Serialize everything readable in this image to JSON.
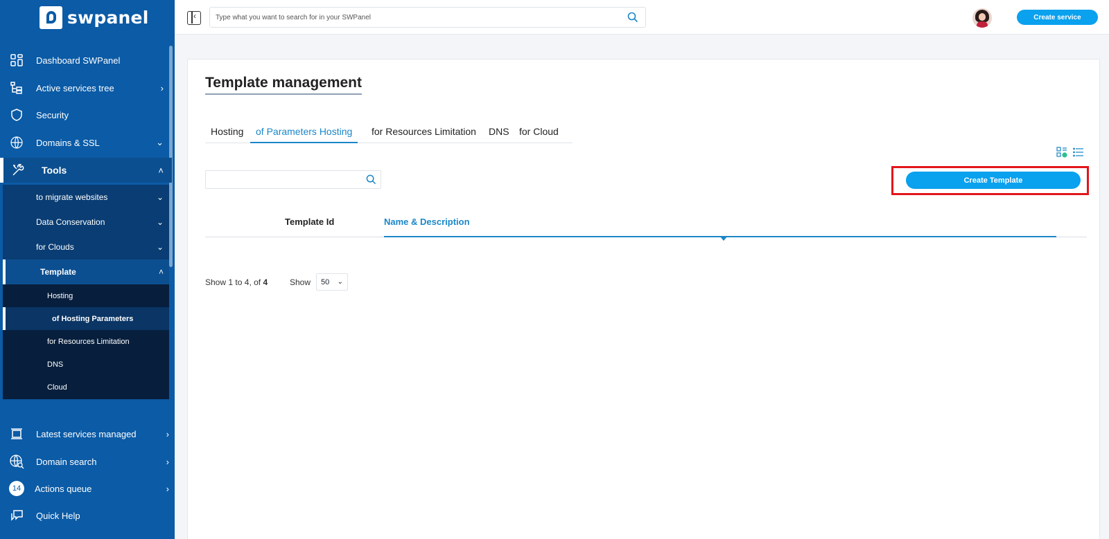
{
  "app": {
    "logo_text": "swpanel"
  },
  "sidebar": {
    "items": [
      {
        "label": "Dashboard SWPanel",
        "icon": "dashboard-grid-icon"
      },
      {
        "label": "Active services tree",
        "icon": "tree-icon",
        "chevron": "›"
      },
      {
        "label": "Security",
        "icon": "shield-icon"
      },
      {
        "label": "Domains & SSL",
        "icon": "www-icon",
        "chevron": "⌄"
      },
      {
        "label": "Tools",
        "icon": "tools-icon",
        "chevron": "˄"
      }
    ],
    "tools_sub": [
      {
        "label": "to migrate websites",
        "chevron": "⌄"
      },
      {
        "label": "Data Conservation",
        "chevron": "⌄"
      },
      {
        "label": "for Clouds",
        "chevron": "⌄"
      },
      {
        "label": "Template",
        "chevron": "˄"
      }
    ],
    "template_sub": [
      {
        "label": "Hosting"
      },
      {
        "label": "of Hosting Parameters"
      },
      {
        "label": "for Resources Limitation"
      },
      {
        "label": "DNS"
      },
      {
        "label": "Cloud"
      }
    ],
    "bottom_items": [
      {
        "label": "Latest services managed",
        "icon": "latest-services-icon",
        "chevron": "›"
      },
      {
        "label": "Domain search",
        "icon": "globe-search-icon",
        "chevron": "›"
      },
      {
        "label": "Actions queue",
        "badge": "14",
        "chevron": "›"
      },
      {
        "label": "Quick Help",
        "icon": "chat-icon"
      }
    ]
  },
  "topbar": {
    "search_placeholder": "Type what you want to search for in your SWPanel",
    "create_service_label": "Create service"
  },
  "main": {
    "title": "Template management",
    "tabs": [
      {
        "label": "Hosting"
      },
      {
        "label": "of Parameters Hosting"
      },
      {
        "label": "for Resources Limitation"
      },
      {
        "label": "DNS"
      },
      {
        "label": "for Cloud"
      }
    ],
    "filter_placeholder": "",
    "create_template_label": "Create Template",
    "table": {
      "columns": [
        "Template Id",
        "Name & Description"
      ]
    },
    "pagination": {
      "show_prefix": "Show",
      "from": "1",
      "to_word": "to",
      "to": "4",
      "of_word": ", of",
      "total": "4",
      "show_label": "Show",
      "page_size": "50"
    }
  },
  "colors": {
    "sidebar_bg": "#0b5ba6",
    "accent": "#0aa1ee",
    "active_tab": "#1a86c7",
    "highlight": "#e2151b"
  }
}
